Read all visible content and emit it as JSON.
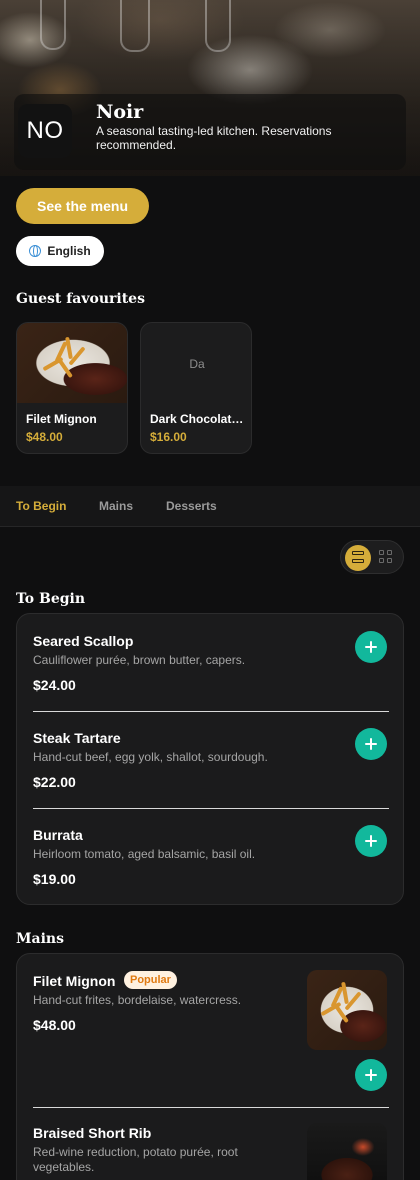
{
  "restaurant": {
    "logo_text": "NO",
    "name": "Noir",
    "description": "A seasonal tasting-led kitchen. Reservations recommended."
  },
  "actions": {
    "see_menu": "See the menu",
    "language": "English"
  },
  "favourites": {
    "heading": "Guest favourites",
    "items": [
      {
        "name": "Filet Mignon",
        "price": "$48.00"
      },
      {
        "name": "Dark Chocolate Fondant",
        "price": "$16.00",
        "placeholder": "Da"
      }
    ]
  },
  "tabs": [
    {
      "label": "To Begin",
      "active": true
    },
    {
      "label": "Mains",
      "active": false
    },
    {
      "label": "Desserts",
      "active": false
    }
  ],
  "view_mode": "list",
  "sections": [
    {
      "heading": "To Begin",
      "items": [
        {
          "title": "Seared Scallop",
          "description": "Cauliflower purée, brown butter, capers.",
          "price": "$24.00"
        },
        {
          "title": "Steak Tartare",
          "description": "Hand-cut beef, egg yolk, shallot, sourdough.",
          "price": "$22.00"
        },
        {
          "title": "Burrata",
          "description": "Heirloom tomato, aged balsamic, basil oil.",
          "price": "$19.00"
        }
      ]
    },
    {
      "heading": "Mains",
      "items": [
        {
          "title": "Filet Mignon",
          "badge": "Popular",
          "description": "Hand-cut frites, bordelaise, watercress.",
          "price": "$48.00"
        },
        {
          "title": "Braised Short Rib",
          "description": "Red-wine reduction, potato purée, root vegetables."
        }
      ]
    }
  ],
  "colors": {
    "accent_gold": "#d5ad3a",
    "add_button": "#12b89c",
    "background": "#0f0f10",
    "card": "#1b1b1c",
    "badge_text": "#e07a12"
  }
}
